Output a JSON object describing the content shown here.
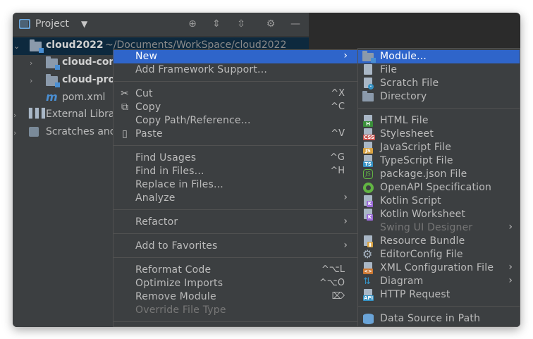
{
  "panel": {
    "title": "Project",
    "tree": [
      {
        "label": "cloud2022",
        "path": " ~/Documents/WorkSpace/cloud2022"
      },
      {
        "label": "cloud-con"
      },
      {
        "label": "cloud-pro"
      },
      {
        "label": "pom.xml"
      },
      {
        "label": "External Libra"
      },
      {
        "label": "Scratches anc"
      }
    ]
  },
  "menu": {
    "new": "New",
    "add_framework": "Add Framework Support...",
    "cut": "Cut",
    "cut_short": "^X",
    "copy": "Copy",
    "copy_short": "^C",
    "copy_path": "Copy Path/Reference...",
    "paste": "Paste",
    "paste_short": "^V",
    "find_usages": "Find Usages",
    "find_usages_short": "^G",
    "find_in_files": "Find in Files...",
    "find_in_files_short": "^H",
    "replace_in_files": "Replace in Files...",
    "analyze": "Analyze",
    "refactor": "Refactor",
    "add_favorites": "Add to Favorites",
    "reformat": "Reformat Code",
    "reformat_short": "^⌥L",
    "optimize": "Optimize Imports",
    "optimize_short": "^⌥O",
    "remove_module": "Remove Module",
    "remove_module_short": "⌦",
    "override": "Override File Type",
    "arrow": "›"
  },
  "submenu": {
    "items": [
      "Module...",
      "File",
      "Scratch File",
      "Directory",
      "HTML File",
      "Stylesheet",
      "JavaScript File",
      "TypeScript File",
      "package.json File",
      "OpenAPI Specification",
      "Kotlin Script",
      "Kotlin Worksheet",
      "Swing UI Designer",
      "Resource Bundle",
      "EditorConfig File",
      "XML Configuration File",
      "Diagram",
      "HTTP Request",
      "Data Source in Path"
    ]
  },
  "colors": {
    "highlight": "#2f65ca",
    "panel_bg": "#3c3f41",
    "selected_row": "#0d293e"
  }
}
